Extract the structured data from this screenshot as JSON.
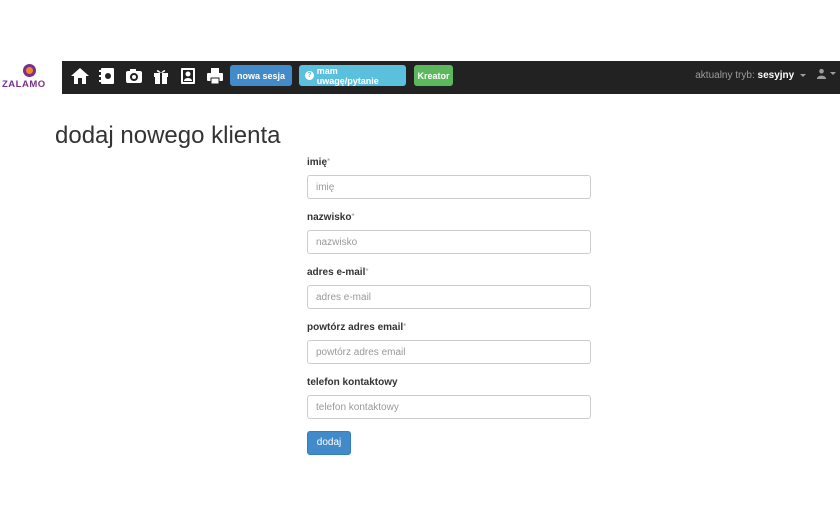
{
  "brand": {
    "name": "ZALAMO"
  },
  "navbar": {
    "icons": [
      "home-icon",
      "contacts-icon",
      "camera-icon",
      "gift-icon",
      "portrait-icon",
      "print-icon"
    ],
    "buttons": {
      "new_session": "nowa sesja",
      "feedback": "mam uwagę/pytanie",
      "wizard": "Kreator"
    },
    "mode_label": "aktualny tryb:",
    "mode_value": "sesyjny"
  },
  "page": {
    "title": "dodaj nowego klienta"
  },
  "form": {
    "required_mark": "*",
    "fields": [
      {
        "label": "imię",
        "placeholder": "imię",
        "required": true
      },
      {
        "label": "nazwisko",
        "placeholder": "nazwisko",
        "required": true
      },
      {
        "label": "adres e-mail",
        "placeholder": "adres e-mail",
        "required": true
      },
      {
        "label": "powtórz adres email",
        "placeholder": "powtórz adres email",
        "required": true
      },
      {
        "label": "telefon kontaktowy",
        "placeholder": "telefon kontaktowy",
        "required": false
      }
    ],
    "submit_label": "dodaj"
  },
  "colors": {
    "navbar_bg": "#222222",
    "primary": "#428bca",
    "info": "#5bc0de",
    "success": "#5cb85c",
    "brand": "#7b2f8c"
  }
}
